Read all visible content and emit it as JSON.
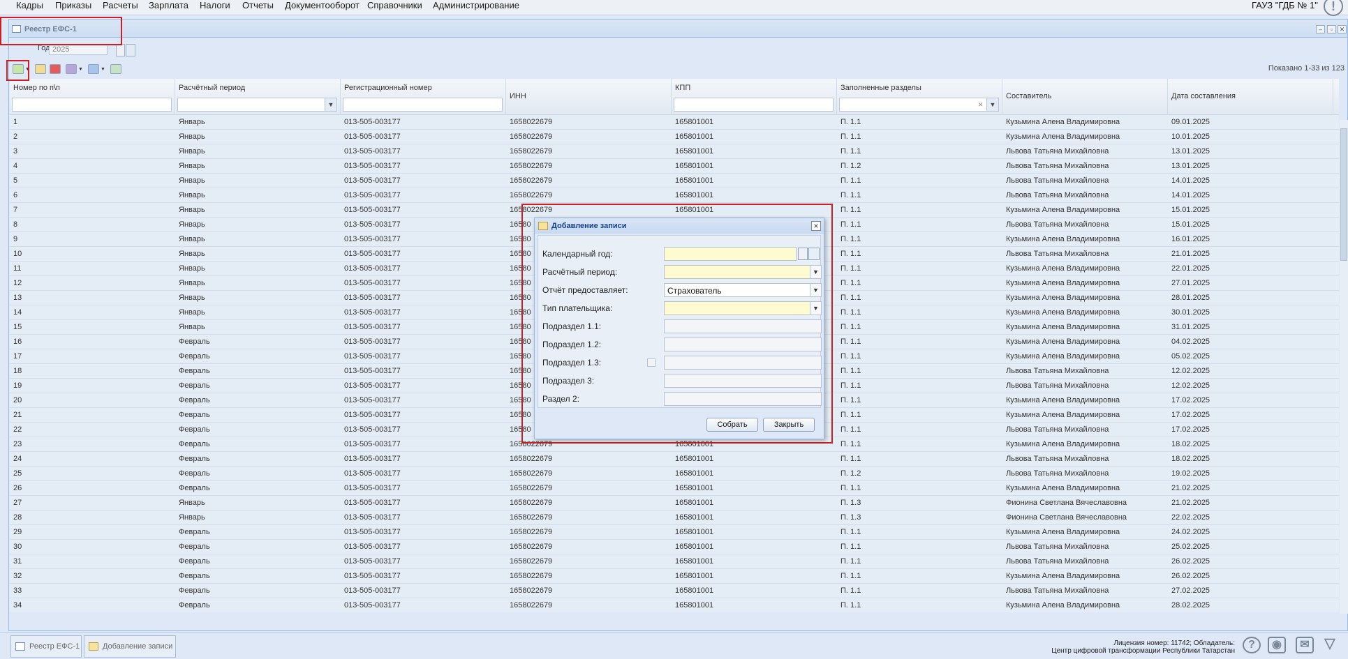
{
  "menu": [
    "Кадры",
    "Приказы",
    "Расчеты",
    "Зарплата",
    "Налоги",
    "Отчеты",
    "Документооборот",
    "Справочники",
    "Администрирование"
  ],
  "org": "ГАУЗ \"ГДБ № 1\"",
  "panel": {
    "title": "Реестр ЕФС-1",
    "year_label": "Год:",
    "year_value": "2025",
    "shown": "Показано 1-33 из 123"
  },
  "grid": {
    "columns": [
      "Номер по п\\п",
      "Расчётный период",
      "Регистрационный номер",
      "ИНН",
      "КПП",
      "Заполненные разделы",
      "Составитель",
      "Дата составления"
    ],
    "rows": [
      [
        "1",
        "Январь",
        "013-505-003177",
        "1658022679",
        "165801001",
        "П. 1.1",
        "Кузьмина Алена Владимировна",
        "09.01.2025"
      ],
      [
        "2",
        "Январь",
        "013-505-003177",
        "1658022679",
        "165801001",
        "П. 1.1",
        "Кузьмина Алена Владимировна",
        "10.01.2025"
      ],
      [
        "3",
        "Январь",
        "013-505-003177",
        "1658022679",
        "165801001",
        "П. 1.1",
        "Львова Татьяна Михайловна",
        "13.01.2025"
      ],
      [
        "4",
        "Январь",
        "013-505-003177",
        "1658022679",
        "165801001",
        "П. 1.2",
        "Львова Татьяна Михайловна",
        "13.01.2025"
      ],
      [
        "5",
        "Январь",
        "013-505-003177",
        "1658022679",
        "165801001",
        "П. 1.1",
        "Львова Татьяна Михайловна",
        "14.01.2025"
      ],
      [
        "6",
        "Январь",
        "013-505-003177",
        "1658022679",
        "165801001",
        "П. 1.1",
        "Львова Татьяна Михайловна",
        "14.01.2025"
      ],
      [
        "7",
        "Январь",
        "013-505-003177",
        "1658022679",
        "165801001",
        "П. 1.1",
        "Кузьмина Алена Владимировна",
        "15.01.2025"
      ],
      [
        "8",
        "Январь",
        "013-505-003177",
        "16580",
        "",
        "П. 1.1",
        "Львова Татьяна Михайловна",
        "15.01.2025"
      ],
      [
        "9",
        "Январь",
        "013-505-003177",
        "16580",
        "",
        "П. 1.1",
        "Кузьмина Алена Владимировна",
        "16.01.2025"
      ],
      [
        "10",
        "Январь",
        "013-505-003177",
        "16580",
        "",
        "П. 1.1",
        "Львова Татьяна Михайловна",
        "21.01.2025"
      ],
      [
        "11",
        "Январь",
        "013-505-003177",
        "16580",
        "",
        "П. 1.1",
        "Кузьмина Алена Владимировна",
        "22.01.2025"
      ],
      [
        "12",
        "Январь",
        "013-505-003177",
        "16580",
        "",
        "П. 1.1",
        "Кузьмина Алена Владимировна",
        "27.01.2025"
      ],
      [
        "13",
        "Январь",
        "013-505-003177",
        "16580",
        "",
        "П. 1.1",
        "Кузьмина Алена Владимировна",
        "28.01.2025"
      ],
      [
        "14",
        "Январь",
        "013-505-003177",
        "16580",
        "",
        "П. 1.1",
        "Кузьмина Алена Владимировна",
        "30.01.2025"
      ],
      [
        "15",
        "Январь",
        "013-505-003177",
        "16580",
        "",
        "П. 1.1",
        "Кузьмина Алена Владимировна",
        "31.01.2025"
      ],
      [
        "16",
        "Февраль",
        "013-505-003177",
        "16580",
        "",
        "П. 1.1",
        "Кузьмина Алена Владимировна",
        "04.02.2025"
      ],
      [
        "17",
        "Февраль",
        "013-505-003177",
        "16580",
        "",
        "П. 1.1",
        "Кузьмина Алена Владимировна",
        "05.02.2025"
      ],
      [
        "18",
        "Февраль",
        "013-505-003177",
        "16580",
        "",
        "П. 1.1",
        "Львова Татьяна Михайловна",
        "12.02.2025"
      ],
      [
        "19",
        "Февраль",
        "013-505-003177",
        "16580",
        "",
        "П. 1.1",
        "Львова Татьяна Михайловна",
        "12.02.2025"
      ],
      [
        "20",
        "Февраль",
        "013-505-003177",
        "16580",
        "",
        "П. 1.1",
        "Кузьмина Алена Владимировна",
        "17.02.2025"
      ],
      [
        "21",
        "Февраль",
        "013-505-003177",
        "16580",
        "",
        "П. 1.1",
        "Кузьмина Алена Владимировна",
        "17.02.2025"
      ],
      [
        "22",
        "Февраль",
        "013-505-003177",
        "16580",
        "",
        "П. 1.1",
        "Львова Татьяна Михайловна",
        "17.02.2025"
      ],
      [
        "23",
        "Февраль",
        "013-505-003177",
        "1658022679",
        "165801001",
        "П. 1.1",
        "Кузьмина Алена Владимировна",
        "18.02.2025"
      ],
      [
        "24",
        "Февраль",
        "013-505-003177",
        "1658022679",
        "165801001",
        "П. 1.1",
        "Львова Татьяна Михайловна",
        "18.02.2025"
      ],
      [
        "25",
        "Февраль",
        "013-505-003177",
        "1658022679",
        "165801001",
        "П. 1.2",
        "Львова Татьяна Михайловна",
        "19.02.2025"
      ],
      [
        "26",
        "Февраль",
        "013-505-003177",
        "1658022679",
        "165801001",
        "П. 1.1",
        "Кузьмина Алена Владимировна",
        "21.02.2025"
      ],
      [
        "27",
        "Январь",
        "013-505-003177",
        "1658022679",
        "165801001",
        "П. 1.3",
        "Фионина Светлана Вячеславовна",
        "21.02.2025"
      ],
      [
        "28",
        "Январь",
        "013-505-003177",
        "1658022679",
        "165801001",
        "П. 1.3",
        "Фионина Светлана Вячеславовна",
        "22.02.2025"
      ],
      [
        "29",
        "Февраль",
        "013-505-003177",
        "1658022679",
        "165801001",
        "П. 1.1",
        "Кузьмина Алена Владимировна",
        "24.02.2025"
      ],
      [
        "30",
        "Февраль",
        "013-505-003177",
        "1658022679",
        "165801001",
        "П. 1.1",
        "Львова Татьяна Михайловна",
        "25.02.2025"
      ],
      [
        "31",
        "Февраль",
        "013-505-003177",
        "1658022679",
        "165801001",
        "П. 1.1",
        "Львова Татьяна Михайловна",
        "26.02.2025"
      ],
      [
        "32",
        "Февраль",
        "013-505-003177",
        "1658022679",
        "165801001",
        "П. 1.1",
        "Кузьмина Алена Владимировна",
        "26.02.2025"
      ],
      [
        "33",
        "Февраль",
        "013-505-003177",
        "1658022679",
        "165801001",
        "П. 1.1",
        "Львова Татьяна Михайловна",
        "27.02.2025"
      ],
      [
        "34",
        "Февраль",
        "013-505-003177",
        "1658022679",
        "165801001",
        "П. 1.1",
        "Кузьмина Алена Владимировна",
        "28.02.2025"
      ]
    ]
  },
  "dialog": {
    "title": "Добавление записи",
    "fields": [
      {
        "label": "Календарный год:",
        "value": ""
      },
      {
        "label": "Расчётный период:",
        "value": ""
      },
      {
        "label": "Отчёт предоставляет:",
        "value": "Страхователь"
      },
      {
        "label": "Тип плательщика:",
        "value": ""
      },
      {
        "label": "Подраздел 1.1:",
        "value": ""
      },
      {
        "label": "Подраздел 1.2:",
        "value": ""
      },
      {
        "label": "Подраздел 1.3:",
        "value": ""
      },
      {
        "label": "Подраздел 3:",
        "value": ""
      },
      {
        "label": "Раздел 2:",
        "value": ""
      }
    ],
    "collect_label": "Собрать",
    "close_label": "Закрыть"
  },
  "taskbar": {
    "tabs": [
      "Реестр ЕФС-1",
      "Добавление записи"
    ]
  },
  "license": {
    "line1": "Лицензия номер: 11742; Обладатель:",
    "line2": "Центр цифровой трансформации Республики Татарстан"
  },
  "icons": [
    "help-icon",
    "camera-icon",
    "mail-icon",
    "collapse-icon"
  ],
  "colors": {
    "highlight": "#cc1f24",
    "required_field": "#fffbd0"
  }
}
